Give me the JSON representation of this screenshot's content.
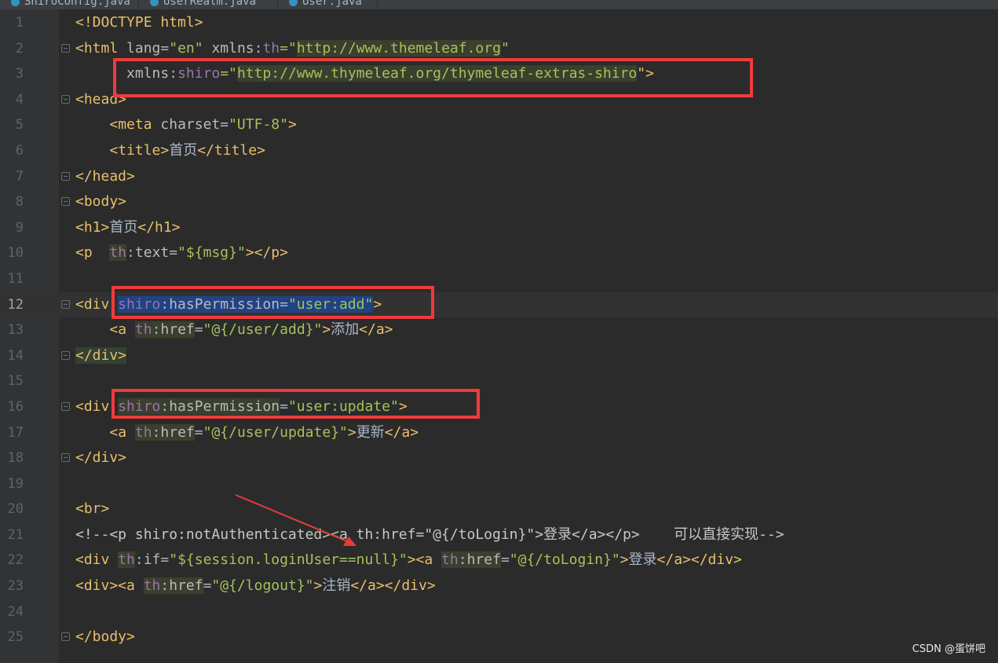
{
  "tabs": [
    {
      "label": "ShiroConfig.java"
    },
    {
      "label": "UserRealm.java"
    },
    {
      "label": "User.java"
    }
  ],
  "editor": {
    "current_line": 12,
    "lines": [
      {
        "num": "1"
      },
      {
        "num": "2"
      },
      {
        "num": "3"
      },
      {
        "num": "4"
      },
      {
        "num": "5"
      },
      {
        "num": "6"
      },
      {
        "num": "7"
      },
      {
        "num": "8"
      },
      {
        "num": "9"
      },
      {
        "num": "10"
      },
      {
        "num": "11"
      },
      {
        "num": "12"
      },
      {
        "num": "13"
      },
      {
        "num": "14"
      },
      {
        "num": "15"
      },
      {
        "num": "16"
      },
      {
        "num": "17"
      },
      {
        "num": "18"
      },
      {
        "num": "19"
      },
      {
        "num": "20"
      },
      {
        "num": "21"
      },
      {
        "num": "22"
      },
      {
        "num": "23"
      },
      {
        "num": "24"
      },
      {
        "num": "25"
      }
    ],
    "code": {
      "l1": {
        "doctype": "<!DOCTYPE html>"
      },
      "l2": {
        "open": "<html ",
        "lang_attr": "lang",
        "eq1": "=",
        "lang_val": "\"en\"",
        "sp": " ",
        "xmlns": "xmlns",
        "colon": ":",
        "th": "th",
        "eq2": "=\"",
        "url": "http://www.themeleaf.org",
        "q": "\""
      },
      "l3": {
        "indent": "      ",
        "xmlns": "xmlns",
        "colon": ":",
        "shiro": "shiro",
        "eq": "=\"",
        "url": "http://www.thymeleaf.org/thymeleaf-extras-shiro",
        "close": "\">"
      },
      "l4": {
        "tag": "<head>"
      },
      "l5": {
        "indent": "    ",
        "open": "<meta ",
        "attr": "charset",
        "eq": "=",
        "val": "\"UTF-8\"",
        "close": ">"
      },
      "l6": {
        "indent": "    ",
        "open": "<title>",
        "text": "首页",
        "close": "</title>"
      },
      "l7": {
        "tag": "</head>"
      },
      "l8": {
        "tag": "<body>"
      },
      "l9": {
        "open": "<h1>",
        "text": "首页",
        "close": "</h1>"
      },
      "l10": {
        "open": "<p  ",
        "th": "th",
        "colon": ":",
        "attr": "text",
        "eq": "=",
        "val": "\"${msg}\"",
        "close": "></p>"
      },
      "l12": {
        "open": "<div ",
        "shiro": "shiro",
        "colon": ":",
        "attr": "hasPermission",
        "eq": "=",
        "val": "\"user:add\"",
        "close": ">"
      },
      "l13": {
        "indent": "    ",
        "open": "<a ",
        "th": "th",
        "colon": ":",
        "attr": "href",
        "eq": "=",
        "val": "\"@{/user/add}\"",
        "gt": ">",
        "text": "添加",
        "close": "</a>"
      },
      "l14": {
        "tag": "</div>"
      },
      "l16": {
        "open": "<div ",
        "shiro": "shiro",
        "colon": ":",
        "attr": "hasPermission",
        "eq": "=",
        "val": "\"user:update\"",
        "close": ">"
      },
      "l17": {
        "indent": "    ",
        "open": "<a ",
        "th": "th",
        "colon": ":",
        "attr": "href",
        "eq": "=",
        "val": "\"@{/user/update}\"",
        "gt": ">",
        "text": "更新",
        "close": "</a>"
      },
      "l18": {
        "tag": "</div>"
      },
      "l20": {
        "tag": "<br>"
      },
      "l21": {
        "comment": "<!--<p shiro:notAuthenticated><a th:href=\"@{/toLogin}\">登录</a></p>    可以直接实现-->"
      },
      "l22": {
        "open": "<div ",
        "th1": "th",
        "colon1": ":",
        "attr1": "if",
        "eq1": "=",
        "val1": "\"${session.loginUser==null}\"",
        "mid": "><a ",
        "th2": "th",
        "colon2": ":",
        "attr2": "href",
        "eq2": "=",
        "val2": "\"@{/toLogin}\"",
        "gt": ">",
        "text": "登录",
        "close": "</a></div>"
      },
      "l23": {
        "open": "<div><a ",
        "th": "th",
        "colon": ":",
        "attr": "href",
        "eq": "=",
        "val": "\"@{/logout}\"",
        "gt": ">",
        "text": "注销",
        "close": "</a></div>"
      },
      "l25": {
        "tag": "</body>"
      }
    }
  },
  "watermark": "CSDN @蛋饼吧",
  "colors": {
    "background": "#2b2b2b",
    "gutter": "#313335",
    "tag": "#e8bf6a",
    "string": "#a5c25c",
    "namespace": "#9876aa",
    "highlight_box": "#ef3b3b",
    "selection": "#214283"
  }
}
